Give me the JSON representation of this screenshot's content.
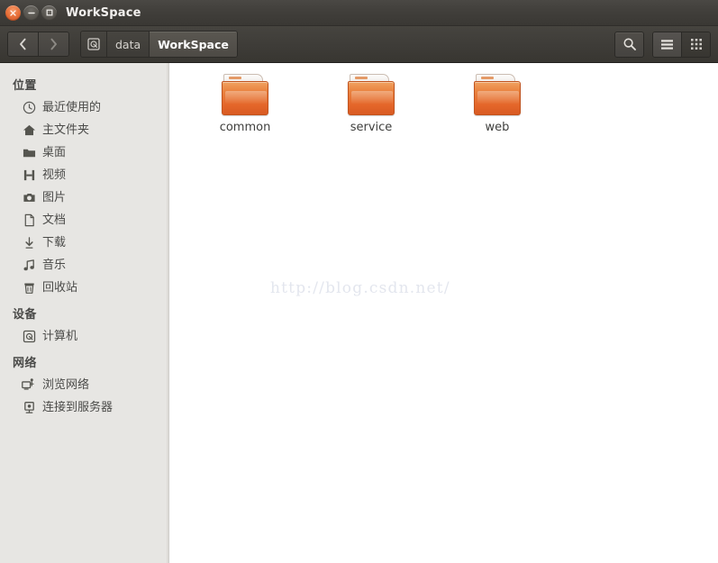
{
  "window": {
    "title": "WorkSpace",
    "controls": [
      {
        "name": "close",
        "glyph": "×"
      },
      {
        "name": "minimize",
        "glyph": "−"
      },
      {
        "name": "maximize",
        "glyph": "□"
      }
    ]
  },
  "toolbar": {
    "back_label": "‹",
    "forward_label": "›",
    "breadcrumbs": [
      {
        "label": "",
        "icon": "computer-icon",
        "active": false
      },
      {
        "label": "data",
        "icon": "",
        "active": false
      },
      {
        "label": "WorkSpace",
        "icon": "",
        "active": true
      }
    ],
    "search_icon": "search-icon",
    "list_view_icon": "list-view-icon",
    "grid_view_icon": "grid-view-icon"
  },
  "sidebar": {
    "sections": [
      {
        "title": "位置",
        "items": [
          {
            "label": "最近使用的",
            "icon": "clock-icon"
          },
          {
            "label": "主文件夹",
            "icon": "home-icon"
          },
          {
            "label": "桌面",
            "icon": "desktop-folder-icon"
          },
          {
            "label": "视频",
            "icon": "video-icon"
          },
          {
            "label": "图片",
            "icon": "camera-icon"
          },
          {
            "label": "文档",
            "icon": "document-icon"
          },
          {
            "label": "下载",
            "icon": "download-icon"
          },
          {
            "label": "音乐",
            "icon": "music-note-icon"
          },
          {
            "label": "回收站",
            "icon": "trash-icon"
          }
        ]
      },
      {
        "title": "设备",
        "items": [
          {
            "label": "计算机",
            "icon": "computer-icon"
          }
        ]
      },
      {
        "title": "网络",
        "items": [
          {
            "label": "浏览网络",
            "icon": "network-browse-icon"
          },
          {
            "label": "连接到服务器",
            "icon": "server-connect-icon"
          }
        ]
      }
    ]
  },
  "content": {
    "files": [
      {
        "name": "common",
        "icon": "folder-icon"
      },
      {
        "name": "service",
        "icon": "folder-icon"
      },
      {
        "name": "web",
        "icon": "folder-icon"
      }
    ],
    "watermark": "http://blog.csdn.net/"
  },
  "colors": {
    "titlebar": "#403e3a",
    "toolbar": "#3e3c38",
    "sidebar": "#e7e6e3",
    "content": "#ffffff",
    "folder_accent": "#e4662a",
    "close_button": "#e8713a",
    "watermark": "#e3e6ee"
  }
}
